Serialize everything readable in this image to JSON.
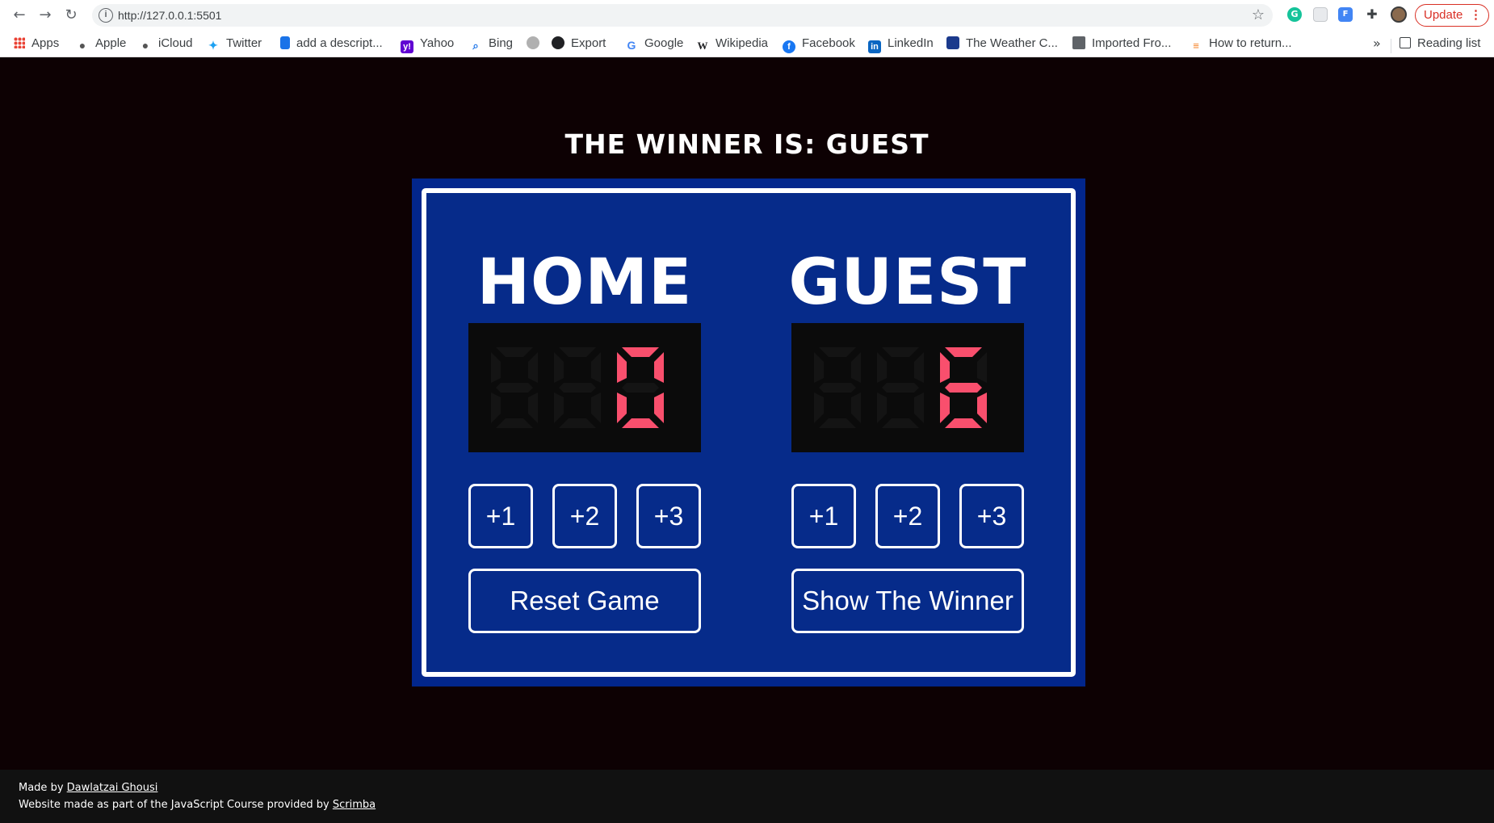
{
  "browser": {
    "url": "http://127.0.0.1:5501",
    "update_label": "Update",
    "update_menu": "⋮",
    "bookmarks": [
      {
        "label": "Apps",
        "icon": "apps-grid-icon"
      },
      {
        "label": "Apple",
        "icon": "apple-icon"
      },
      {
        "label": "iCloud",
        "icon": "apple-icon"
      },
      {
        "label": "Twitter",
        "icon": "twitter-icon"
      },
      {
        "label": "add a descript...",
        "icon": "bookmark-icon"
      },
      {
        "label": "Yahoo",
        "icon": "yahoo-icon"
      },
      {
        "label": "Bing",
        "icon": "search-icon"
      },
      {
        "label": "",
        "icon": "robot-icon"
      },
      {
        "label": "Export",
        "icon": "globe-icon"
      },
      {
        "label": "Google",
        "icon": "google-icon"
      },
      {
        "label": "Wikipedia",
        "icon": "wikipedia-icon"
      },
      {
        "label": "Facebook",
        "icon": "facebook-icon"
      },
      {
        "label": "LinkedIn",
        "icon": "linkedin-icon"
      },
      {
        "label": "The Weather C...",
        "icon": "weather-icon"
      },
      {
        "label": "Imported Fro...",
        "icon": "folder-icon"
      },
      {
        "label": "How to return...",
        "icon": "stackoverflow-icon"
      }
    ],
    "more_label": "»",
    "reading_list_label": "Reading list"
  },
  "page": {
    "winner_text": "THE WINNER IS: GUEST",
    "home": {
      "name": "HOME",
      "score": "0",
      "buttons": [
        "+1",
        "+2",
        "+3"
      ],
      "action_label": "Reset Game"
    },
    "guest": {
      "name": "GUEST",
      "score": "6",
      "buttons": [
        "+1",
        "+2",
        "+3"
      ],
      "action_label": "Show The Winner"
    },
    "colors": {
      "page_bg": "#0d0103",
      "board_outer": "#02268c",
      "board_inner": "#062b8a",
      "digit_on": "#f94f6d",
      "digit_off": "#141414"
    }
  },
  "footer": {
    "made_by_prefix": "Made by",
    "author": "Dawlatzai Ghousi",
    "course_prefix": "Website made as part of the JavaScript Course provided by",
    "provider": "Scrimba"
  }
}
